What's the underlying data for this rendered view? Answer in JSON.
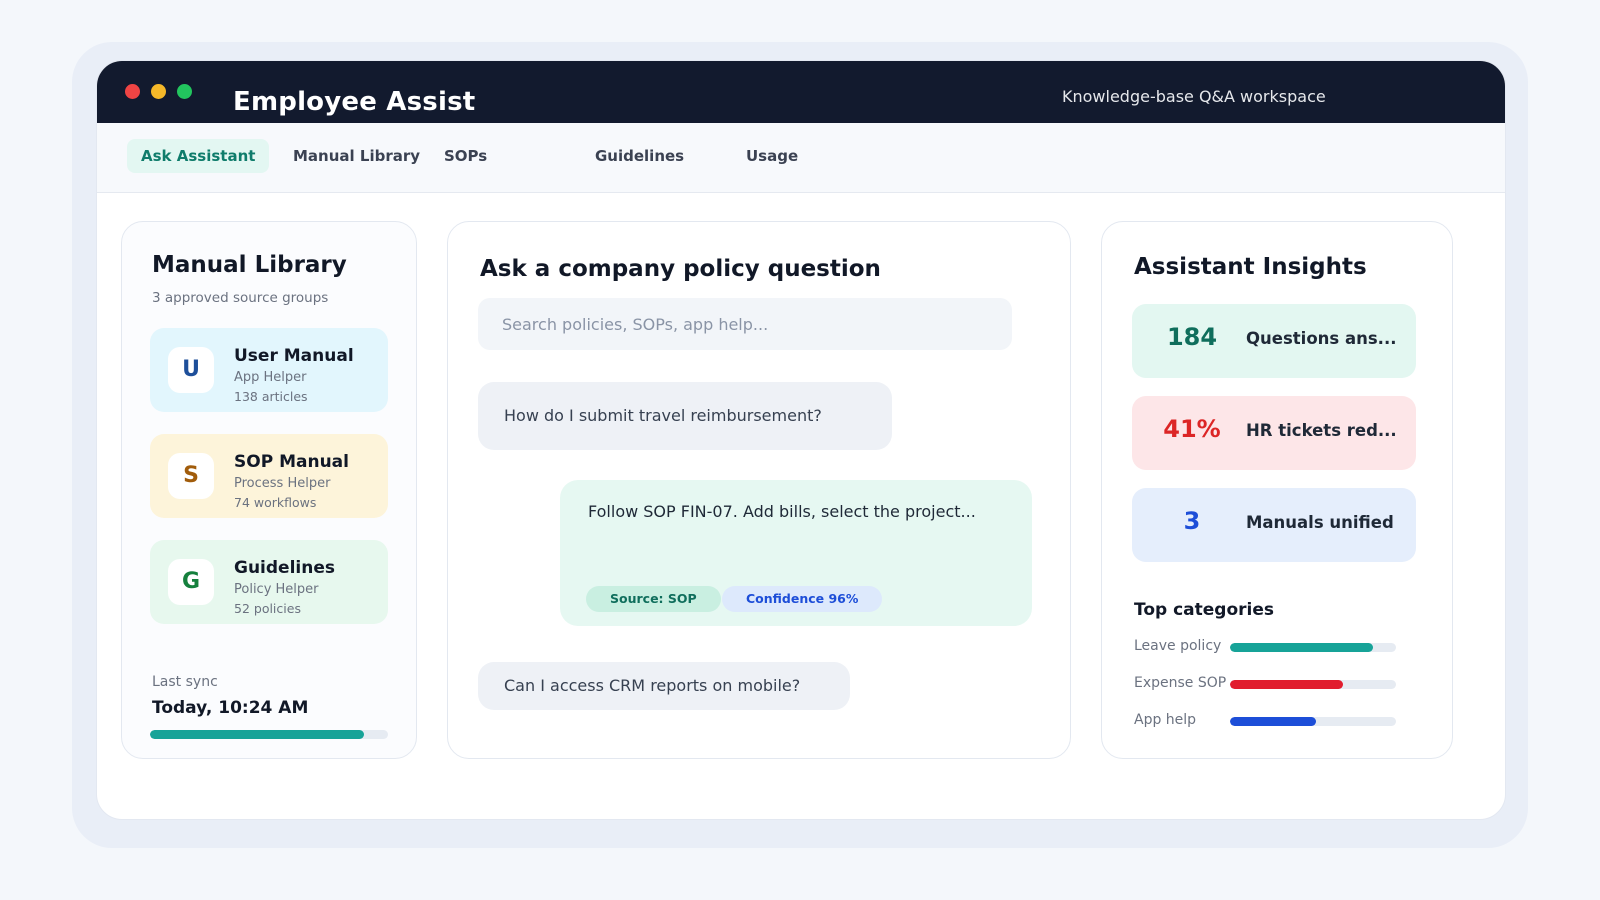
{
  "app": {
    "title": "Employee Assist",
    "subtitle": "Knowledge-base Q&A workspace"
  },
  "tabs": [
    {
      "label": "Ask Assistant",
      "active": true
    },
    {
      "label": "Manual Library",
      "active": false
    },
    {
      "label": "SOPs",
      "active": false
    },
    {
      "label": "Guidelines",
      "active": false
    },
    {
      "label": "Usage",
      "active": false
    }
  ],
  "library": {
    "title": "Manual Library",
    "subtitle": "3 approved source groups",
    "items": [
      {
        "badge": "U",
        "name": "User Manual",
        "type": "App Helper",
        "count": "138 articles",
        "color": "#e2f6fd"
      },
      {
        "badge": "S",
        "name": "SOP Manual",
        "type": "Process Helper",
        "count": "74 workflows",
        "color": "#fdf4da"
      },
      {
        "badge": "G",
        "name": "Guidelines",
        "type": "Policy Helper",
        "count": "52 policies",
        "color": "#e7f8ee"
      }
    ],
    "sync_label": "Last sync",
    "sync_value": "Today, 10:24 AM",
    "sync_progress": 0.9
  },
  "ask": {
    "title": "Ask a company policy question",
    "search_placeholder": "Search policies, SOPs, app help...",
    "question_1": "How do I submit travel reimbursement?",
    "answer": "Follow SOP FIN-07. Add bills, select the project...",
    "source_chip": "Source: SOP",
    "confidence_chip": "Confidence 96%",
    "question_2": "Can I access CRM reports on mobile?"
  },
  "insights": {
    "title": "Assistant Insights",
    "stats": [
      {
        "value": "184",
        "label": "Questions ans...",
        "color": "#0f6e5c"
      },
      {
        "value": "41%",
        "label": "HR tickets red...",
        "color": "#dc2626"
      },
      {
        "value": "3",
        "label": "Manuals unified",
        "color": "#1d4ed8"
      }
    ],
    "categories_title": "Top categories",
    "categories": [
      {
        "label": "Leave policy",
        "fraction": 0.86,
        "color": "#17a398"
      },
      {
        "label": "Expense SOP",
        "fraction": 0.68,
        "color": "#e11d2e"
      },
      {
        "label": "App help",
        "fraction": 0.52,
        "color": "#1d4ed8"
      }
    ]
  }
}
